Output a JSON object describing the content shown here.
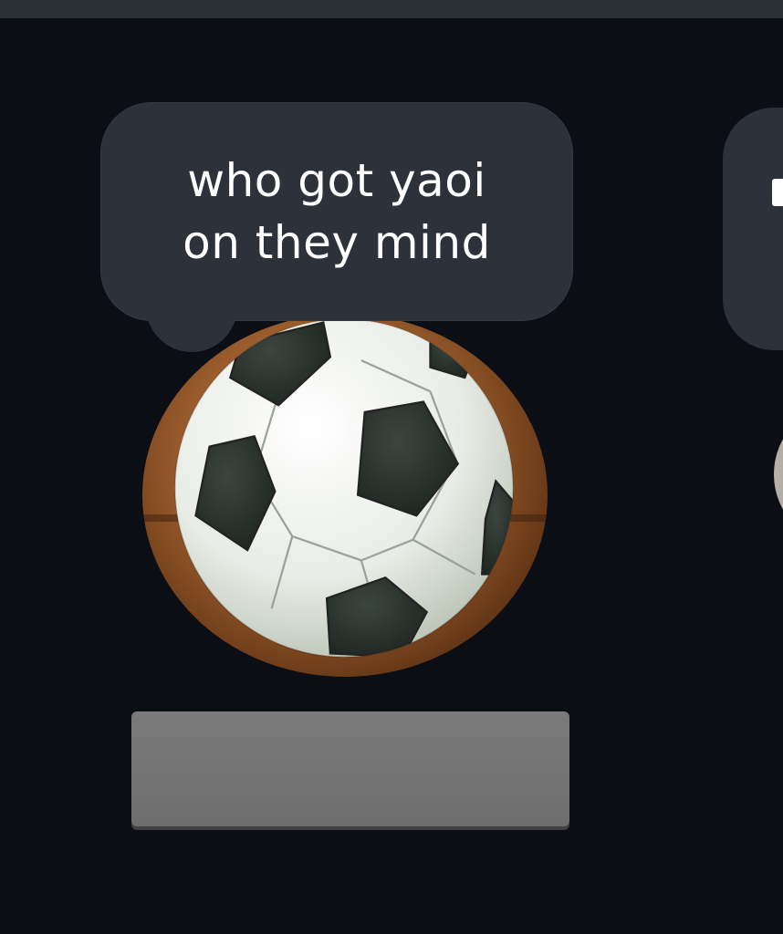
{
  "note": {
    "line1": "who got yaoi",
    "line2": "on they mind"
  },
  "avatar": {
    "icon": "soccer-ball-icon"
  },
  "colors": {
    "background": "#0b0e15",
    "bubble": "#2d3139",
    "text": "#ffffff",
    "name_placeholder": "#737373"
  }
}
